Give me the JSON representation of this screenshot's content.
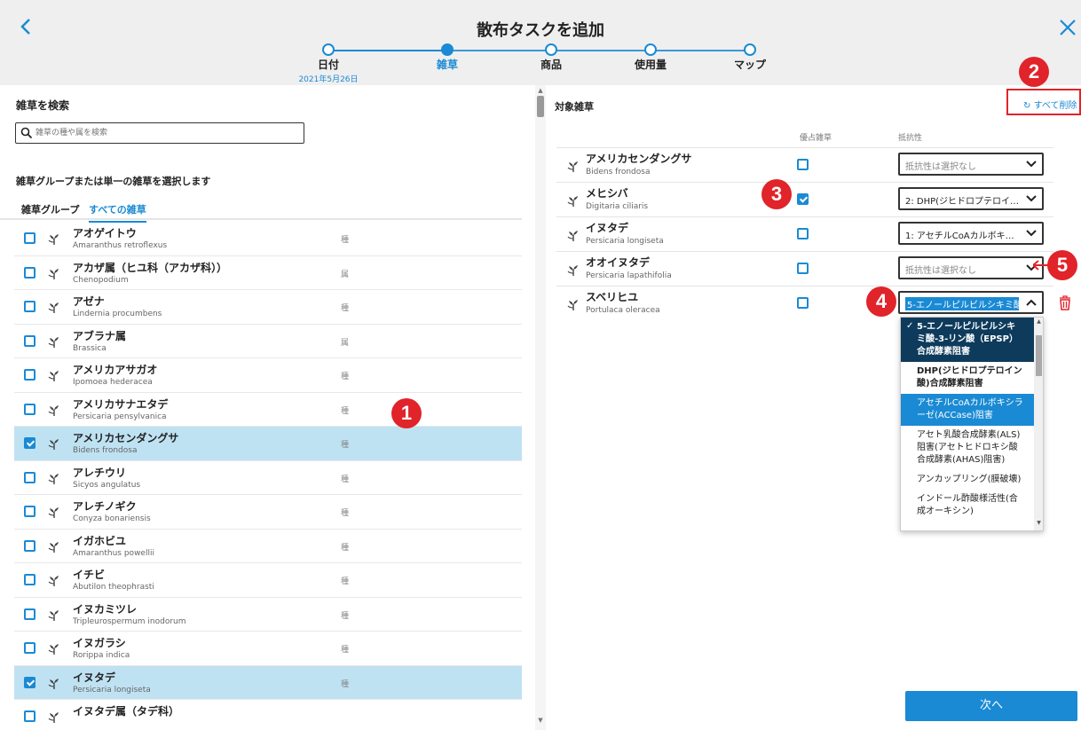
{
  "header": {
    "title": "散布タスクを追加",
    "steps": [
      {
        "label": "日付",
        "sub": "2021年5月26日",
        "state": "done"
      },
      {
        "label": "雑草",
        "sub": "",
        "state": "active"
      },
      {
        "label": "商品",
        "sub": "",
        "state": "todo"
      },
      {
        "label": "使用量",
        "sub": "",
        "state": "todo"
      },
      {
        "label": "マップ",
        "sub": "",
        "state": "todo"
      }
    ]
  },
  "left": {
    "search_title": "雑草を検索",
    "search_placeholder": "雑草の種や属を検索",
    "select_prompt": "雑草グループまたは単一の雑草を選択します",
    "tabs": [
      "雑草グループ",
      "すべての雑草"
    ],
    "active_tab": "すべての雑草",
    "weeds": [
      {
        "name": "アオゲイトウ",
        "sci": "Amaranthus retroflexus",
        "type": "種",
        "checked": false
      },
      {
        "name": "アカザ属（ヒユ科（アカザ科））",
        "sci": "Chenopodium",
        "type": "属",
        "checked": false
      },
      {
        "name": "アゼナ",
        "sci": "Lindernia procumbens",
        "type": "種",
        "checked": false
      },
      {
        "name": "アブラナ属",
        "sci": "Brassica",
        "type": "属",
        "checked": false
      },
      {
        "name": "アメリカアサガオ",
        "sci": "Ipomoea hederacea",
        "type": "種",
        "checked": false
      },
      {
        "name": "アメリカサナエタデ",
        "sci": "Persicaria pensylvanica",
        "type": "種",
        "checked": false
      },
      {
        "name": "アメリカセンダングサ",
        "sci": "Bidens frondosa",
        "type": "種",
        "checked": true
      },
      {
        "name": "アレチウリ",
        "sci": "Sicyos angulatus",
        "type": "種",
        "checked": false
      },
      {
        "name": "アレチノギク",
        "sci": "Conyza bonariensis",
        "type": "種",
        "checked": false
      },
      {
        "name": "イガホビユ",
        "sci": "Amaranthus powellii",
        "type": "種",
        "checked": false
      },
      {
        "name": "イチビ",
        "sci": "Abutilon theophrasti",
        "type": "種",
        "checked": false
      },
      {
        "name": "イヌカミツレ",
        "sci": "Tripleurospermum inodorum",
        "type": "種",
        "checked": false
      },
      {
        "name": "イヌガラシ",
        "sci": "Rorippa indica",
        "type": "種",
        "checked": false
      },
      {
        "name": "イヌタデ",
        "sci": "Persicaria longiseta",
        "type": "種",
        "checked": true
      },
      {
        "name": "イヌタデ属（タデ科）",
        "sci": "",
        "type": "",
        "checked": false
      }
    ]
  },
  "right": {
    "title": "対象雑草",
    "clear_all": "すべて削除",
    "col_dominant": "優占雑草",
    "col_resistance": "抵抗性",
    "targets": [
      {
        "name": "アメリカセンダングサ",
        "sci": "Bidens frondosa",
        "dominant": false,
        "resistance": "抵抗性は選択なし",
        "placeholder": true,
        "open": false
      },
      {
        "name": "メヒシバ",
        "sci": "Digitaria ciliaris",
        "dominant": true,
        "resistance": "2: DHP(ジヒドロプテロイ…",
        "placeholder": false,
        "open": false
      },
      {
        "name": "イヌタデ",
        "sci": "Persicaria longiseta",
        "dominant": false,
        "resistance": "1: アセチルCoAカルボキ…",
        "placeholder": false,
        "open": false
      },
      {
        "name": "オオイヌタデ",
        "sci": "Persicaria lapathifolia",
        "dominant": false,
        "resistance": "抵抗性は選択なし",
        "placeholder": true,
        "open": false
      },
      {
        "name": "スベリヒユ",
        "sci": "Portulaca oleracea",
        "dominant": false,
        "resistance": "5-エノールピルビルシキミ酸",
        "placeholder": false,
        "open": true
      }
    ],
    "dropdown_options": [
      {
        "label": "5-エノールピルビルシキミ酸-3-リン酸（EPSP）合成酵素阻害",
        "state": "selected"
      },
      {
        "label": "DHP(ジヒドロプテロイン酸)合成酵素阻害",
        "state": "bold"
      },
      {
        "label": "アセチルCoAカルボキシラーゼ(ACCase)阻害",
        "state": "highlight"
      },
      {
        "label": "アセト乳酸合成酵素(ALS)阻害(アセトヒドロキシ酸合成酵素(AHAS)阻害)",
        "state": "plain"
      },
      {
        "label": "アンカップリング(膜破壊)",
        "state": "plain"
      },
      {
        "label": "インドール酢酸様活性(合成オーキシン)",
        "state": "plain"
      }
    ],
    "next_label": "次へ"
  },
  "annotations": [
    "1",
    "2",
    "3",
    "4",
    "5"
  ],
  "colors": {
    "accent": "#1a8ad4",
    "annotation": "#e0242a",
    "selected_row": "#bfe2f3"
  }
}
